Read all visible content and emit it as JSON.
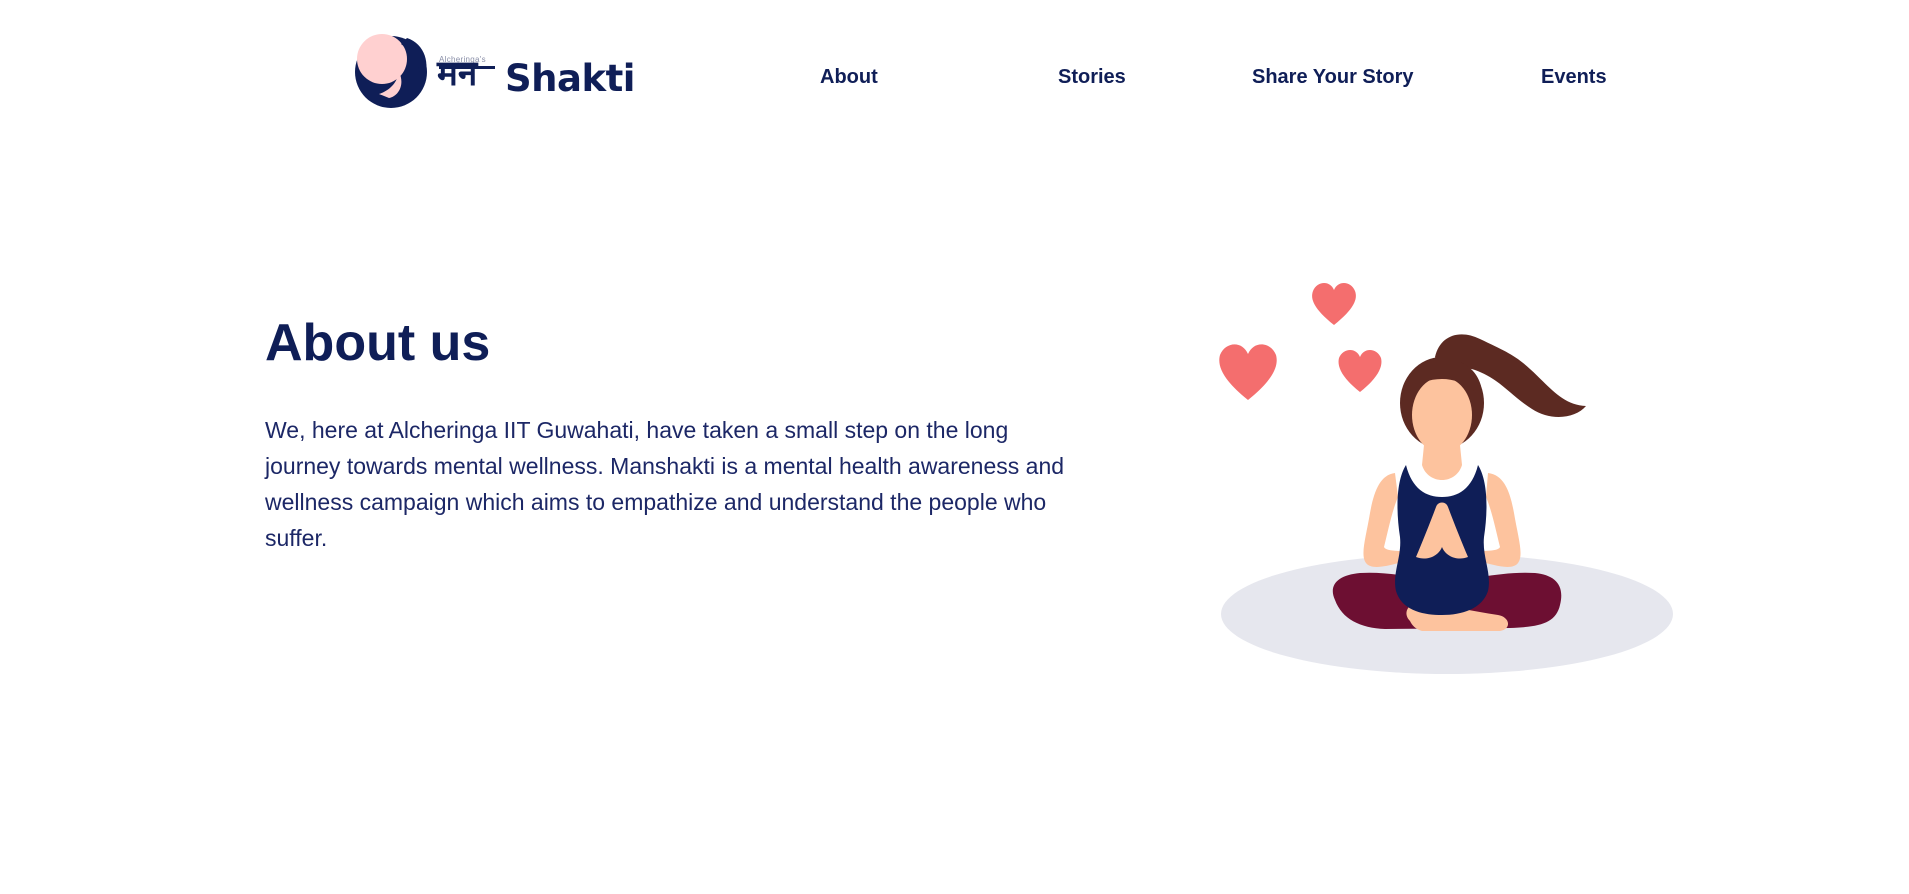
{
  "header": {
    "logo": {
      "small_text": "Alcheringa's",
      "devanagari": "मन",
      "latin": "Shakti",
      "colors": {
        "navy": "#0f1e57",
        "pink": "#ffd0d0"
      }
    },
    "nav": [
      {
        "label": "About"
      },
      {
        "label": "Stories"
      },
      {
        "label": "Share Your Story"
      },
      {
        "label": "Events"
      }
    ]
  },
  "about": {
    "title": "About us",
    "paragraph": "We, here at Alcheringa IIT Guwahati, have taken a small step on the long journey towards mental wellness. Manshakti is a mental health awareness and wellness campaign which aims to empathize and understand the people who suffer.",
    "illustration": {
      "icon": "meditating-woman-with-hearts-illustration",
      "colors": {
        "heart": "#f46e6e",
        "hair": "#5c2a22",
        "skin": "#fdc39e",
        "top": "#0f1e57",
        "pants": "#6d0f32",
        "mat": "#e6e7ee"
      }
    }
  }
}
